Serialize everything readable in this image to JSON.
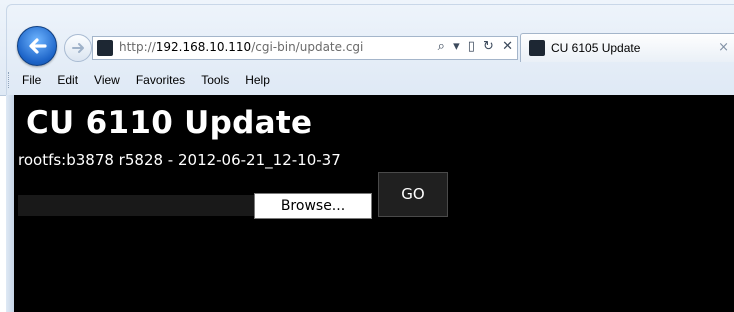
{
  "browser": {
    "url_prefix": "http://",
    "url_host": "192.168.10.110",
    "url_path": "/cgi-bin/update.cgi",
    "tab_title": "CU 6105 Update",
    "tab_close": "×",
    "address_tools": {
      "search": "⌕",
      "dropdown": "▾",
      "compat": "▯",
      "refresh": "↻",
      "stop": "✕"
    },
    "menu": [
      "File",
      "Edit",
      "View",
      "Favorites",
      "Tools",
      "Help"
    ],
    "icons": {
      "back": "back-arrow-icon",
      "forward": "forward-arrow-icon",
      "site": "site-favicon-icon"
    },
    "accent_color": "#1c63c7"
  },
  "page": {
    "title": "CU 6110 Update",
    "version": "rootfs:b3878 r5828 - 2012-06-21_12-10-37",
    "browse_label": "Browse...",
    "go_label": "GO",
    "background_color": "#000000",
    "text_color": "#ffffff"
  }
}
